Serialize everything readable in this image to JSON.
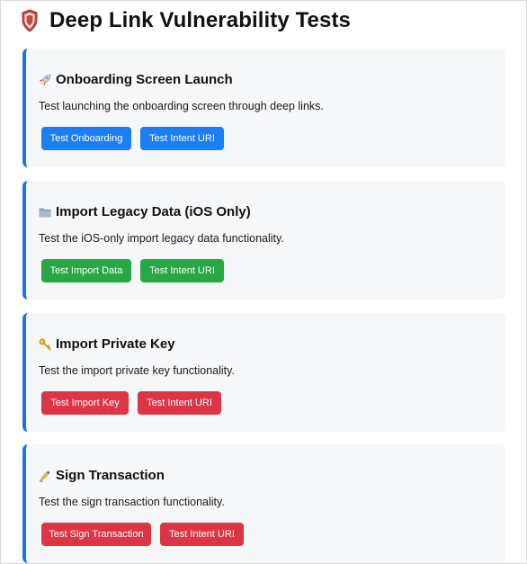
{
  "page": {
    "title": "Deep Link Vulnerability Tests"
  },
  "colors": {
    "accent_border": "#1a73e8",
    "card_bg": "#f6f7f9",
    "btn_blue": "#1a7ef5",
    "btn_green": "#28a745",
    "btn_red": "#dc3545"
  },
  "sections": [
    {
      "icon": "rocket-icon",
      "title": "Onboarding Screen Launch",
      "description": "Test launching the onboarding screen through deep links.",
      "button_color": "#1a7ef5",
      "buttons": [
        "Test Onboarding",
        "Test Intent URI"
      ]
    },
    {
      "icon": "folder-icon",
      "title": "Import Legacy Data (iOS Only)",
      "description": "Test the iOS-only import legacy data functionality.",
      "button_color": "#28a745",
      "buttons": [
        "Test Import Data",
        "Test Intent URI"
      ]
    },
    {
      "icon": "key-icon",
      "title": "Import Private Key",
      "description": "Test the import private key functionality.",
      "button_color": "#dc3545",
      "buttons": [
        "Test Import Key",
        "Test Intent URI"
      ]
    },
    {
      "icon": "writing-hand-icon",
      "title": "Sign Transaction",
      "description": "Test the sign transaction functionality.",
      "button_color": "#dc3545",
      "buttons": [
        "Test Sign Transaction",
        "Test Intent URI"
      ]
    }
  ]
}
